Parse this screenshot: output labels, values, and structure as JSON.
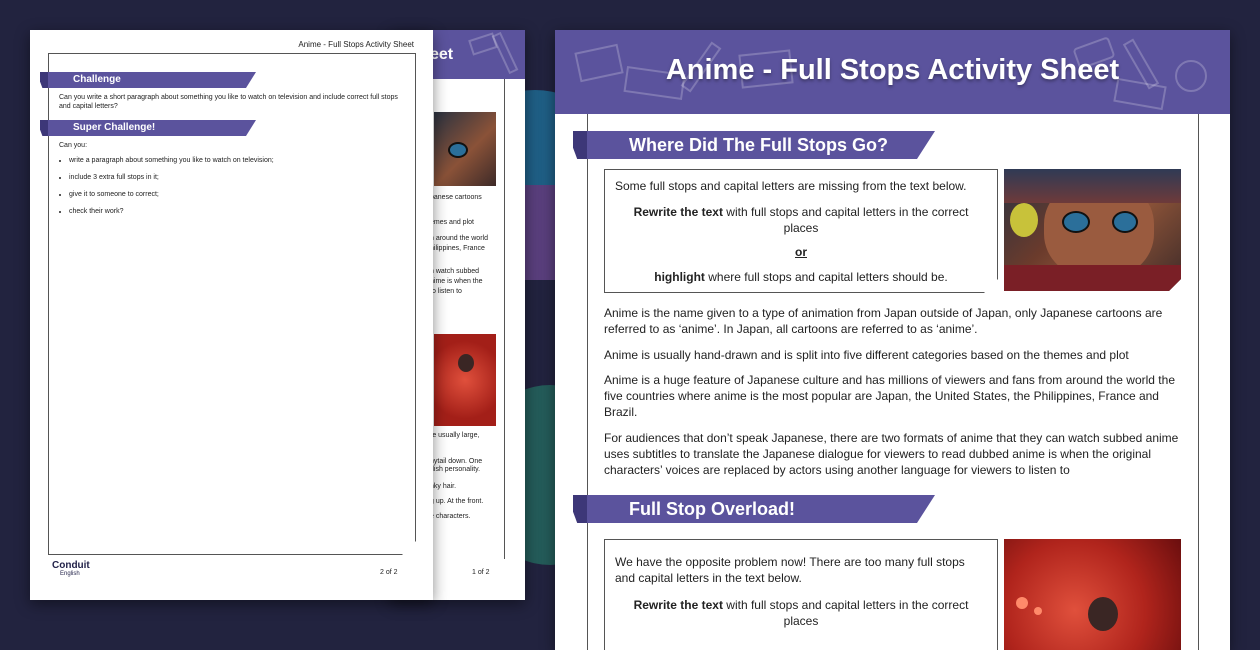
{
  "front": {
    "title": "Anime - Full Stops Activity Sheet",
    "section1": {
      "heading": "Where Did The Full Stops Go?",
      "box_intro": "Some full stops and capital letters are missing from the text below.",
      "box_instruction_bold": "Rewrite the text",
      "box_instruction_rest": " with full stops and capital letters in the correct places",
      "box_or": "or",
      "box_highlight_bold": "highlight",
      "box_highlight_rest": " where full stops and capital letters should be.",
      "paragraphs": [
        "Anime is the name given to a type of animation from Japan outside of Japan, only Japanese cartoons are referred to as ‘anime’. In Japan, all cartoons are referred to as ‘anime’.",
        "Anime is usually hand-drawn and is split into five different categories based on the themes and plot",
        "Anime is a huge feature of Japanese culture and has millions of viewers and fans from around the world the five countries where anime is the most popular are Japan, the United States, the Philippines, France and Brazil.",
        "For audiences that don’t speak Japanese, there are two formats of anime that they can watch subbed anime uses subtitles to translate the Japanese dialogue for viewers to read dubbed anime is when the original characters’ voices are replaced by actors using another language for viewers to listen to"
      ]
    },
    "section2": {
      "heading": "Full Stop Overload!",
      "box_intro": "We have the opposite problem now! There are too many full stops and capital letters in the text below.",
      "box_instruction_bold": "Rewrite the text",
      "box_instruction_rest": " with full stops and capital letters in the correct places"
    }
  },
  "middle": {
    "title_fragment": "eet",
    "page_number": "1 of 2",
    "snippets_top": [
      "panese cartoons",
      "emes and plot",
      "n around the world",
      "hilippines, France",
      "n watch subbed",
      "nime is when the",
      "to listen to"
    ],
    "snippets_bottom": [
      "re usually large,",
      "nytail down. One",
      "dish personality.",
      "nky hair.",
      "g up. At the front.",
      "e characters."
    ]
  },
  "back": {
    "header_title": "Anime - Full Stops Activity Sheet",
    "challenge": {
      "heading": "Challenge",
      "text": "Can you write a short paragraph about something you like to watch on television and include correct full stops and capital letters?"
    },
    "super_challenge": {
      "heading": "Super Challenge!",
      "intro": "Can you:",
      "items": [
        "write a paragraph about something you like to watch on television;",
        "include 3 extra full stops in it;",
        "give it to someone to correct;",
        "check their work?"
      ]
    },
    "logo_name": "Conduit",
    "logo_sub": "English",
    "page_number": "2 of 2"
  },
  "colors": {
    "background": "#22233f",
    "accent": "#5b539d",
    "accent_dark": "#3d3778"
  }
}
